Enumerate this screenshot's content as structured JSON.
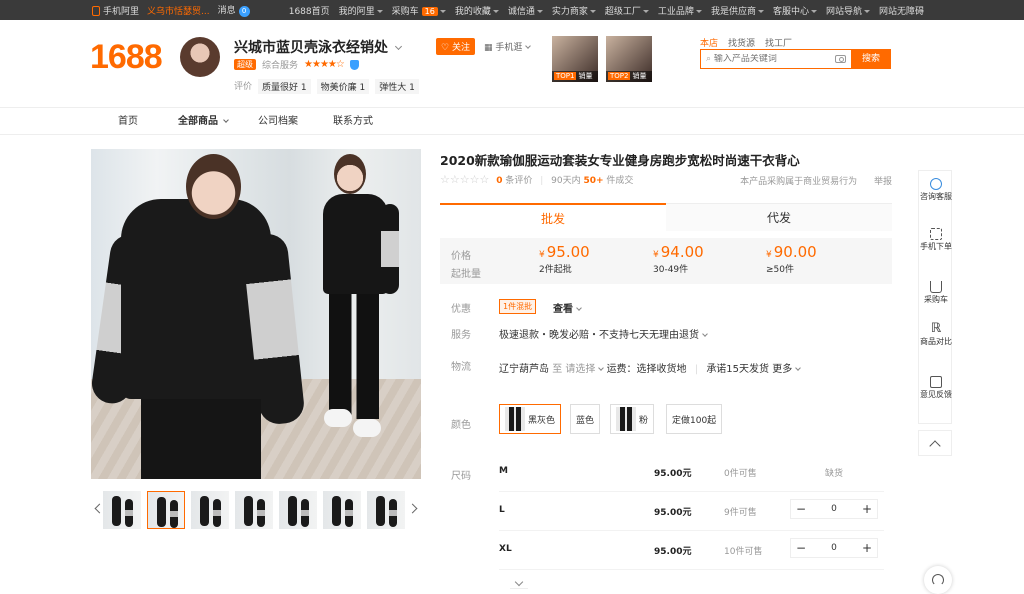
{
  "topbar": {
    "left": [
      "手机阿里",
      "义乌市恬瑟贸...",
      "消息"
    ],
    "msg_count": "0",
    "right": [
      "1688首页",
      "我的阿里",
      "采购车",
      "我的收藏",
      "诚信通",
      "实力商家",
      "超级工厂",
      "工业品牌",
      "我是供应商",
      "客服中心",
      "网站导航",
      "网站无障碍"
    ],
    "cart_count": "16"
  },
  "header": {
    "logo": "1688",
    "shop_name": "兴城市蓝贝壳泳衣经销处",
    "badge": "超级",
    "service_label": "综合服务",
    "stars": "★★★★☆",
    "rating_label": "评价",
    "tags": [
      "质量很好 1",
      "物美价廉 1",
      "弹性大 1"
    ],
    "follow": "关注",
    "mobile": "手机逛",
    "top_products": [
      {
        "rank": "TOP1",
        "label": "销量"
      },
      {
        "rank": "TOP2",
        "label": "销量"
      }
    ],
    "search_tabs": [
      "本店",
      "找货源",
      "找工厂"
    ],
    "search_placeholder": "输入产品关键词",
    "search_btn": "搜索"
  },
  "nav": [
    "首页",
    "全部商品",
    "公司档案",
    "联系方式"
  ],
  "product": {
    "title": "2020新款瑜伽服运动套装女专业健身房跑步宽松时尚速干衣背心",
    "stars": "☆☆☆☆☆",
    "review_count": "0",
    "review_label": "条评价",
    "sales_prefix": "90天内",
    "sales": "50+",
    "sales_suffix": "件成交",
    "procurement_note": "本产品采购属于商业贸易行为",
    "report": "举报",
    "tabs": [
      "批发",
      "代发"
    ],
    "price_label": "价格",
    "moq_label": "起批量",
    "currency": "¥",
    "prices": [
      {
        "price": "95.00",
        "moq": "2件起批"
      },
      {
        "price": "94.00",
        "moq": "30-49件"
      },
      {
        "price": "90.00",
        "moq": "≥50件"
      }
    ],
    "promo_label": "优惠",
    "promo_tag": "1件混批",
    "promo_view": "查看",
    "service_label": "服务",
    "service_text": "极速退款・晚发必赔・不支持七天无理由退货",
    "logistics_label": "物流",
    "from": "辽宁葫芦岛",
    "to": "至",
    "choose": "请选择",
    "freight": "运费：选择收货地",
    "promise": "承诺15天发货",
    "more": "更多",
    "color_label": "颜色",
    "colors": [
      "黑灰色",
      "蓝色",
      "粉",
      "定做100起"
    ],
    "size_label": "尺码",
    "sizes": [
      {
        "name": "M",
        "price": "95.00元",
        "stock": "0件可售",
        "status": "缺货"
      },
      {
        "name": "L",
        "price": "95.00元",
        "stock": "9件可售",
        "qty": "0"
      },
      {
        "name": "XL",
        "price": "95.00元",
        "stock": "10件可售",
        "qty": "0"
      }
    ],
    "minus": "−",
    "plus": "+"
  },
  "sidebar": [
    "咨询客服",
    "手机下单",
    "采购车",
    "商品对比",
    "意见反馈"
  ]
}
